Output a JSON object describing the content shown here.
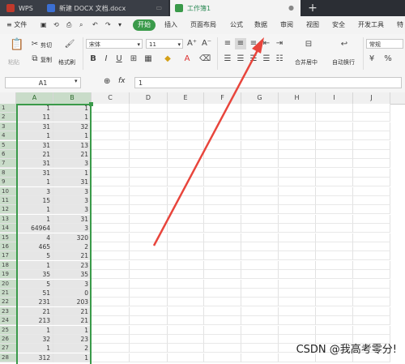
{
  "tabs": {
    "wps_label": "WPS",
    "doc_label": "新建 DOCX 文档.docx",
    "book_label": "工作簿1",
    "plus": "+"
  },
  "menu": {
    "file": "≡ 文件",
    "start": "开始",
    "insert": "插入",
    "page_layout": "页面布局",
    "formula": "公式",
    "data": "数据",
    "review": "审阅",
    "view": "视图",
    "security": "安全",
    "dev_tools": "开发工具",
    "special": "特"
  },
  "ribbon": {
    "paste": "粘贴",
    "cut": "剪切",
    "copy": "复制",
    "format_painter": "格式刷",
    "font_name": "宋体",
    "font_size": "11",
    "merge_center": "合并居中",
    "auto_wrap": "自动换行",
    "number_format": "常规",
    "percent": "%",
    "bold": "B",
    "italic": "I",
    "underline": "U",
    "font_color_a": "A",
    "dropdown": "▾"
  },
  "formula_bar": {
    "cell_ref": "A1",
    "fx": "fx",
    "value": "1"
  },
  "columns": [
    "A",
    "B",
    "C",
    "D",
    "E",
    "F",
    "G",
    "H",
    "I",
    "J"
  ],
  "rows": [
    {
      "n": "1",
      "a": "1",
      "b": "1"
    },
    {
      "n": "2",
      "a": "11",
      "b": "1"
    },
    {
      "n": "3",
      "a": "31",
      "b": "32"
    },
    {
      "n": "4",
      "a": "1",
      "b": "1"
    },
    {
      "n": "5",
      "a": "31",
      "b": "13"
    },
    {
      "n": "6",
      "a": "21",
      "b": "21"
    },
    {
      "n": "7",
      "a": "31",
      "b": "3"
    },
    {
      "n": "8",
      "a": "31",
      "b": "1"
    },
    {
      "n": "9",
      "a": "1",
      "b": "31"
    },
    {
      "n": "10",
      "a": "3",
      "b": "3"
    },
    {
      "n": "11",
      "a": "15",
      "b": "3"
    },
    {
      "n": "12",
      "a": "1",
      "b": "3"
    },
    {
      "n": "13",
      "a": "1",
      "b": "31"
    },
    {
      "n": "14",
      "a": "64964",
      "b": "3"
    },
    {
      "n": "15",
      "a": "4",
      "b": "320"
    },
    {
      "n": "16",
      "a": "465",
      "b": "2"
    },
    {
      "n": "17",
      "a": "5",
      "b": "21"
    },
    {
      "n": "18",
      "a": "1",
      "b": "23"
    },
    {
      "n": "19",
      "a": "35",
      "b": "35"
    },
    {
      "n": "20",
      "a": "5",
      "b": "3"
    },
    {
      "n": "21",
      "a": "51",
      "b": "0"
    },
    {
      "n": "22",
      "a": "231",
      "b": "203"
    },
    {
      "n": "23",
      "a": "21",
      "b": "21"
    },
    {
      "n": "24",
      "a": "213",
      "b": "21"
    },
    {
      "n": "25",
      "a": "1",
      "b": "1"
    },
    {
      "n": "26",
      "a": "32",
      "b": "23"
    },
    {
      "n": "27",
      "a": "1",
      "b": "2"
    },
    {
      "n": "28",
      "a": "312",
      "b": "1"
    }
  ],
  "watermark": "CSDN @我高考零分!",
  "colors": {
    "accent_green": "#3a9a4a",
    "arrow_red": "#e8453c",
    "tab_bar": "#2b2e34"
  }
}
